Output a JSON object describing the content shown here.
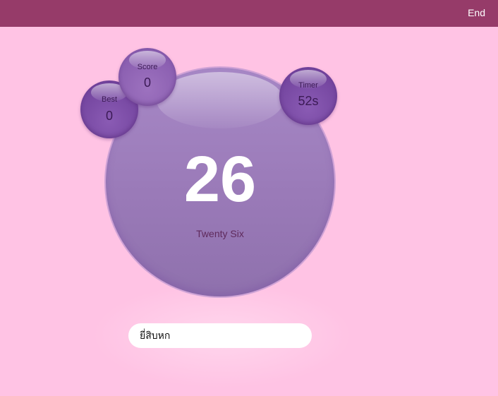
{
  "header": {
    "end_label": "End",
    "bar_color": "#963b69"
  },
  "game": {
    "current_number": "26",
    "current_number_words": "Twenty Six",
    "best": {
      "label": "Best",
      "value": "0"
    },
    "score": {
      "label": "Score",
      "value": "0"
    },
    "timer": {
      "label": "Timer",
      "value": "52s"
    }
  },
  "answer": {
    "value": "ยี่สิบหก"
  },
  "colors": {
    "background": "#ffc3e4",
    "bubble": "#9a7ab8",
    "small_bubble": "#74459f"
  }
}
